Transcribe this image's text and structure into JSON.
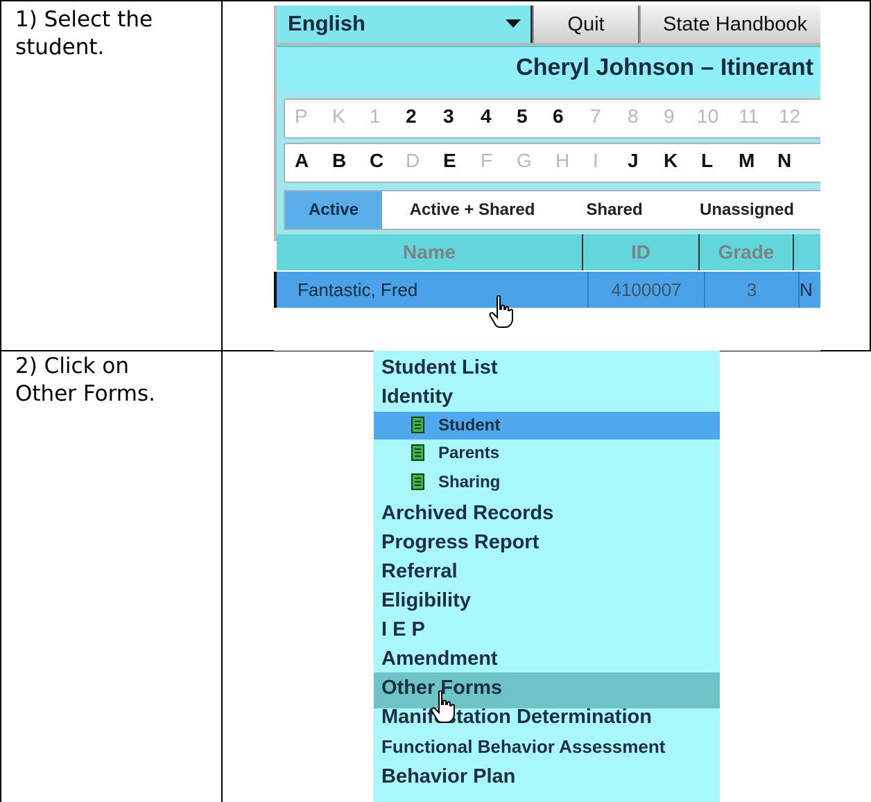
{
  "steps": [
    {
      "text": "1) Select the\nstudent."
    },
    {
      "text": "2) Click on\nOther Forms."
    }
  ],
  "app": {
    "language": {
      "selected": "English"
    },
    "buttons": {
      "quit": "Quit",
      "handbook": "State Handbook"
    },
    "title": "Cheryl Johnson  –  Itinerant",
    "grade_chips": [
      {
        "label": "P",
        "enabled": false
      },
      {
        "label": "K",
        "enabled": false
      },
      {
        "label": "1",
        "enabled": false
      },
      {
        "label": "2",
        "enabled": true
      },
      {
        "label": "3",
        "enabled": true
      },
      {
        "label": "4",
        "enabled": true
      },
      {
        "label": "5",
        "enabled": true
      },
      {
        "label": "6",
        "enabled": true
      },
      {
        "label": "7",
        "enabled": false
      },
      {
        "label": "8",
        "enabled": false
      },
      {
        "label": "9",
        "enabled": false
      },
      {
        "label": "10",
        "enabled": false
      },
      {
        "label": "11",
        "enabled": false
      },
      {
        "label": "12",
        "enabled": false
      }
    ],
    "letter_chips": [
      {
        "label": "A",
        "enabled": true
      },
      {
        "label": "B",
        "enabled": true
      },
      {
        "label": "C",
        "enabled": true
      },
      {
        "label": "D",
        "enabled": false
      },
      {
        "label": "E",
        "enabled": true
      },
      {
        "label": "F",
        "enabled": false
      },
      {
        "label": "G",
        "enabled": false
      },
      {
        "label": "H",
        "enabled": false
      },
      {
        "label": "I",
        "enabled": false
      },
      {
        "label": "J",
        "enabled": true
      },
      {
        "label": "K",
        "enabled": true
      },
      {
        "label": "L",
        "enabled": true
      },
      {
        "label": "M",
        "enabled": true
      },
      {
        "label": "N",
        "enabled": true
      }
    ],
    "tabs": {
      "active": "Active",
      "active_shared": "Active + Shared",
      "shared": "Shared",
      "unassigned": "Unassigned"
    },
    "grid": {
      "headers": {
        "name": "Name",
        "id": "ID",
        "grade": "Grade"
      },
      "row": {
        "name": "Fantastic, Fred",
        "id": "4100007",
        "grade": "3",
        "extra": "N"
      }
    }
  },
  "nav": {
    "student_list": "Student List",
    "identity": "Identity",
    "sub_items": {
      "student": "Student",
      "parents": "Parents",
      "sharing": "Sharing"
    },
    "archived_records": "Archived Records",
    "progress_report": "Progress Report",
    "referral": "Referral",
    "eligibility": "Eligibility",
    "iep": "I E P",
    "amendment": "Amendment",
    "other_forms": "Other Forms",
    "manifestation": "Manifestation Determination",
    "fba": "Functional Behavior Assessment",
    "behavior_plan": "Behavior Plan"
  }
}
